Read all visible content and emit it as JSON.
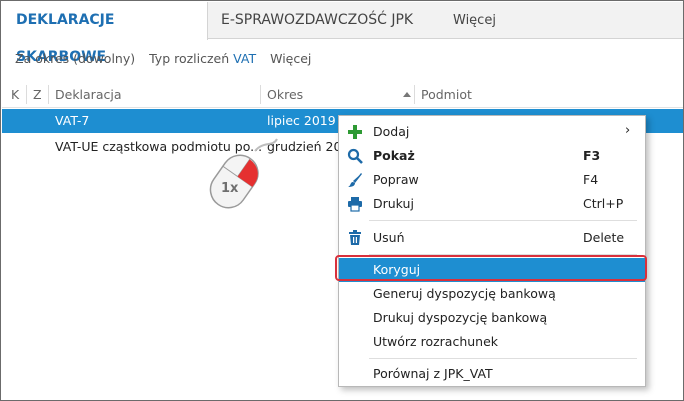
{
  "tabs": [
    {
      "label": "DEKLARACJE SKARBOWE"
    },
    {
      "label": "E-SPRAWOZDAWCZOŚĆ JPK"
    },
    {
      "label": "Więcej"
    }
  ],
  "filters": {
    "period": "Za okres (dowolny)",
    "type_label": "Typ rozliczeń",
    "type_value": "VAT",
    "more": "Więcej"
  },
  "columns": [
    "K",
    "Z",
    "Deklaracja",
    "Okres",
    "Podmiot"
  ],
  "rows": [
    {
      "deklaracja": "VAT-7",
      "okres": "lipiec 2019"
    },
    {
      "deklaracja": "VAT-UE cząstkowa podmiotu po...",
      "okres": "grudzień 20"
    }
  ],
  "mouse_badge": "1x",
  "menu": {
    "items": [
      {
        "label": "Dodaj",
        "shortcut": ""
      },
      {
        "label": "Pokaż",
        "shortcut": "F3"
      },
      {
        "label": "Popraw",
        "shortcut": "F4"
      },
      {
        "label": "Drukuj",
        "shortcut": "Ctrl+P"
      },
      {
        "label": "Usuń",
        "shortcut": "Delete"
      },
      {
        "label": "Koryguj",
        "shortcut": ""
      },
      {
        "label": "Generuj dyspozycję bankową",
        "shortcut": ""
      },
      {
        "label": "Drukuj dyspozycję bankową",
        "shortcut": ""
      },
      {
        "label": "Utwórz rozrachunek",
        "shortcut": ""
      },
      {
        "label": "Porównaj z JPK_VAT",
        "shortcut": ""
      }
    ],
    "submenu_arrow": "›"
  },
  "colors": {
    "accent": "#1e6fb2",
    "selection": "#1e8ed1",
    "highlight_ring": "#d9303b",
    "add_icon": "#2e9a34",
    "delete_icon": "#1d6aa8"
  }
}
